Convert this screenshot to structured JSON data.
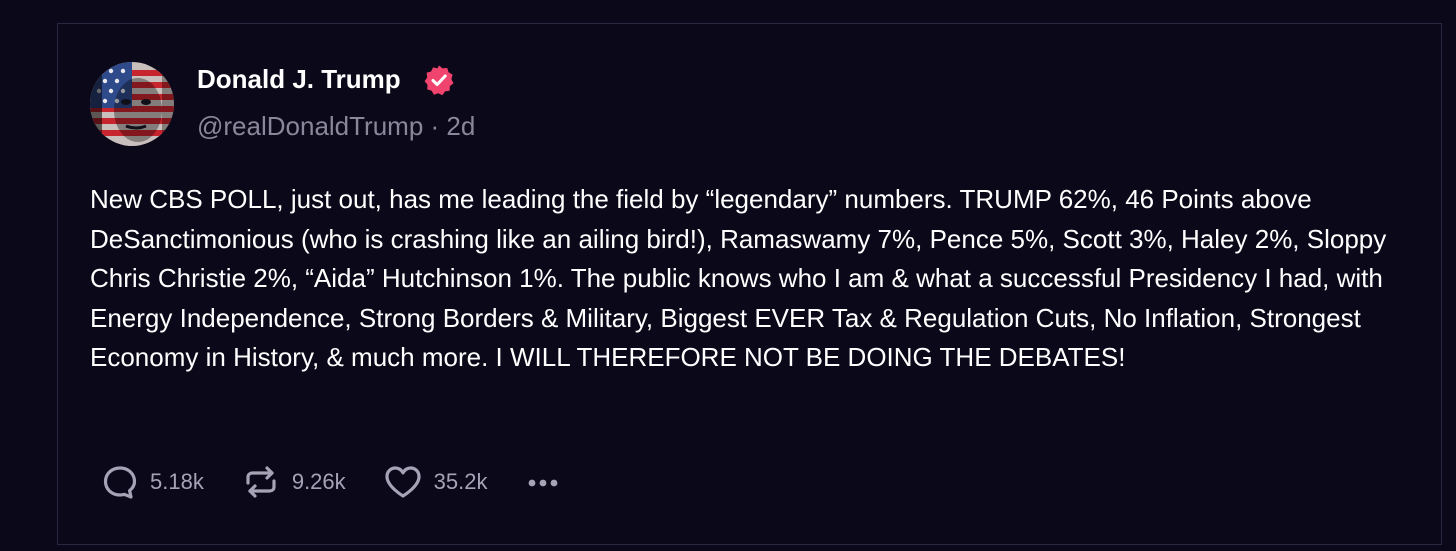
{
  "post": {
    "author_name": "Donald J. Trump",
    "handle": "@realDonaldTrump",
    "separator": " · ",
    "time_ago": "2d",
    "verified": true,
    "avatar_icon": "flag-painted-face-avatar",
    "body": "New CBS POLL, just out, has me leading the field by “legendary” numbers. TRUMP 62%, 46 Points above DeSanctimonious (who is crashing like an ailing bird!), Ramaswamy 7%, Pence 5%, Scott 3%, Haley 2%, Sloppy Chris Christie 2%, “Aida” Hutchinson 1%. The public knows who I am & what a successful Presidency I had, with Energy Independence, Strong Borders & Military, Biggest EVER Tax & Regulation Cuts, No Inflation, Strongest Economy in History, & much more. I WILL THEREFORE NOT BE DOING THE DEBATES!"
  },
  "actions": {
    "reply": {
      "icon": "speech-bubble-icon",
      "count": "5.18k"
    },
    "repost": {
      "icon": "repost-arrows-icon",
      "count": "9.26k"
    },
    "like": {
      "icon": "heart-icon",
      "count": "35.2k"
    },
    "more": {
      "icon": "more-dots-icon"
    }
  },
  "colors": {
    "background": "#0b0819",
    "text": "#ffffff",
    "muted": "#8b879a",
    "icon": "#a7a3b6",
    "verified": "#f0446f",
    "border": "#2a2640"
  }
}
